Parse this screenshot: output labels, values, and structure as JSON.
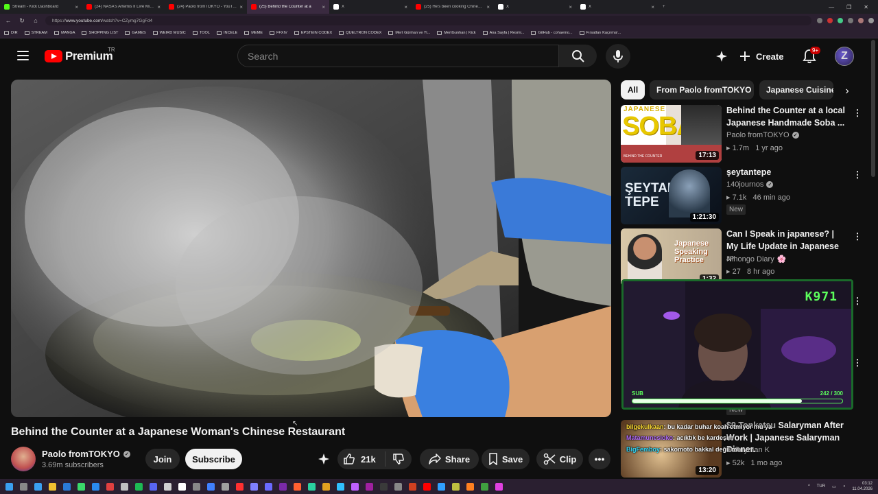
{
  "browser": {
    "tabs": [
      {
        "title": "Stream - Kick Dashboard",
        "favicon_color": "#53fc18",
        "active": false
      },
      {
        "title": "(24) NASA's Artemis II Live Mission",
        "favicon_color": "#ff0000",
        "active": false
      },
      {
        "title": "(24) Paolo fromTOKYO - YouTube",
        "favicon_color": "#ff0000",
        "active": false
      },
      {
        "title": "(25) Behind the Counter at a",
        "favicon_color": "#ff0000",
        "active": true
      },
      {
        "title": "X",
        "favicon_color": "#ffffff",
        "active": false
      },
      {
        "title": "(25) He's been cooking Chinese fo",
        "favicon_color": "#ff0000",
        "active": false
      },
      {
        "title": "X",
        "favicon_color": "#ffffff",
        "active": false
      },
      {
        "title": "X",
        "favicon_color": "#ffffff",
        "active": false
      }
    ],
    "url_prefix": "https://",
    "url_domain": "www.youtube.com",
    "url_path": "/watch?v=CZymg7GgFd4",
    "bookmarks": [
      "DIR",
      "STREAM",
      "MANGA",
      "SHOPPING LIST",
      "GAMES",
      "WEIRD MUSIC",
      "TOOL",
      "INCELE",
      "MEME",
      "FFXIV",
      "EPSTEIN CODEX",
      "QUELTRON CODEX",
      "Mert Günhan ve Yi...",
      "MertGunhan | Kick",
      "Ana Sayfa | Resmi...",
      "GitHub - cohaemo...",
      "Fırsatları Kaçırma!..."
    ]
  },
  "header": {
    "brand": "Premium",
    "country": "TR",
    "search_placeholder": "Search",
    "create_label": "Create",
    "notification_count": "9+",
    "accent": "#ff0000"
  },
  "video": {
    "title": "Behind the Counter at a Japanese Woman's Chinese Restaurant",
    "channel": "Paolo fromTOKYO",
    "subscribers": "3.69m subscribers",
    "join_label": "Join",
    "subscribe_label": "Subscribe",
    "likes": "21k",
    "share_label": "Share",
    "save_label": "Save",
    "clip_label": "Clip"
  },
  "chips": [
    {
      "label": "All",
      "selected": true
    },
    {
      "label": "From Paolo fromTOKYO",
      "selected": false
    },
    {
      "label": "Japanese Cuisine",
      "selected": false
    }
  ],
  "related": [
    {
      "title": "Behind the Counter at a local Japanese Handmade Soba ...",
      "channel": "Paolo fromTOKYO",
      "verified": true,
      "views": "1.7m",
      "age": "1 yr ago",
      "duration": "17:13",
      "thumb_text": "SOBA",
      "thumb_top": "JAPANESE",
      "thumb_sub": "BEHIND THE COUNTER"
    },
    {
      "title": "şeytantepe",
      "channel": "140journos",
      "verified": true,
      "views": "7.1k",
      "age": "46 min ago",
      "duration": "1:21:30",
      "badge": "New",
      "thumb_text": "ŞEYTAN TEPE"
    },
    {
      "title": "Can I Speak in japanese? | My Life Update in Japanese",
      "title_suffix": "JP",
      "channel": "Nihongo Diary",
      "channel_suffix": "🌸",
      "views": "27",
      "age": "8 hr ago",
      "duration": "1:32",
      "thumb_text": "Japanese Speaking Practice"
    },
    {
      "title": "Salaryman After Work | Japanese Salaryman Dinner.",
      "title_prefix": "$9 Tonkatsu",
      "channel": "Salaryman K",
      "views": "52k",
      "age": "1 mo ago",
      "duration": "13:20",
      "badge": "New"
    }
  ],
  "stream_overlay": {
    "counter": "K971",
    "sub_label": "SUB",
    "sub_count": "242 / 300",
    "sub_fraction": 0.8067,
    "chat": [
      {
        "user": "bilgekulkaan",
        "user_color": "#ffdd33",
        "text": ": bu kadar buhar koah etmiyor mu ya"
      },
      {
        "user": "Matamunesioko",
        "user_color": "#b06aff",
        "text": ": acıktık be kardeşim"
      },
      {
        "user": "BigFemboy",
        "user_color": "#33ddff",
        "text": ": sakomoto bakkal değil mi"
      }
    ]
  },
  "taskbar": {
    "lang": "TUR",
    "time": "03:12",
    "date": "11.04.2026"
  }
}
